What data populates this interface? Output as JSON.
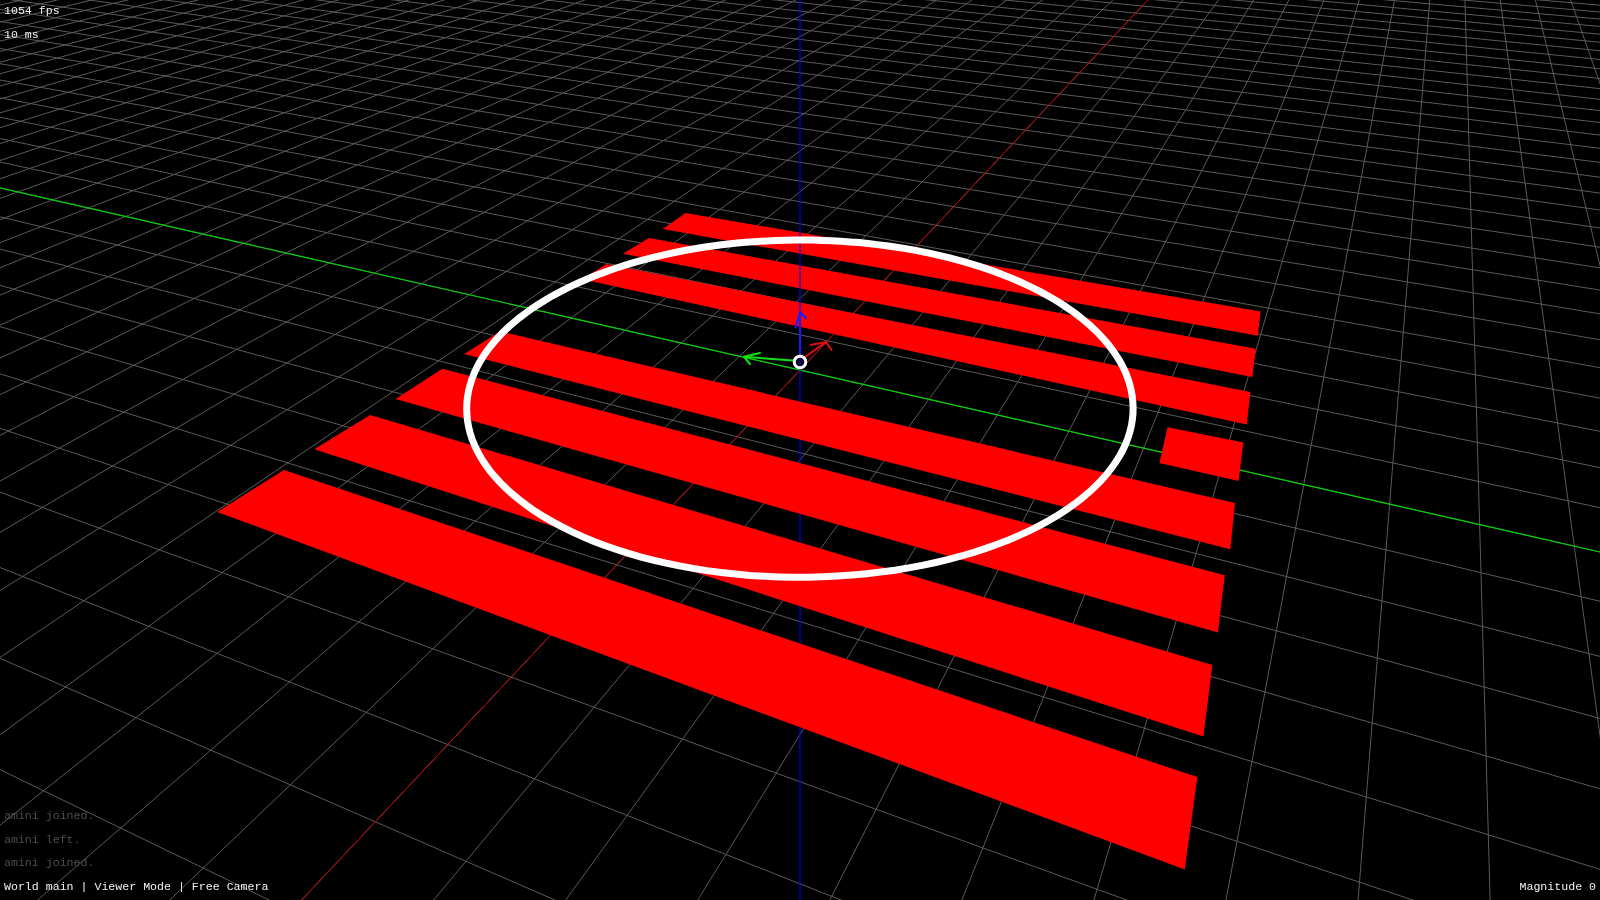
{
  "stats": {
    "fps": "1054 fps",
    "frame_time": "10 ms"
  },
  "log": [
    {
      "text": "amini joined."
    },
    {
      "text": "amini left."
    },
    {
      "text": "amini joined."
    }
  ],
  "status_bar": {
    "left": "World main | Viewer Mode | Free Camera",
    "right": "Magnitude 0"
  }
}
